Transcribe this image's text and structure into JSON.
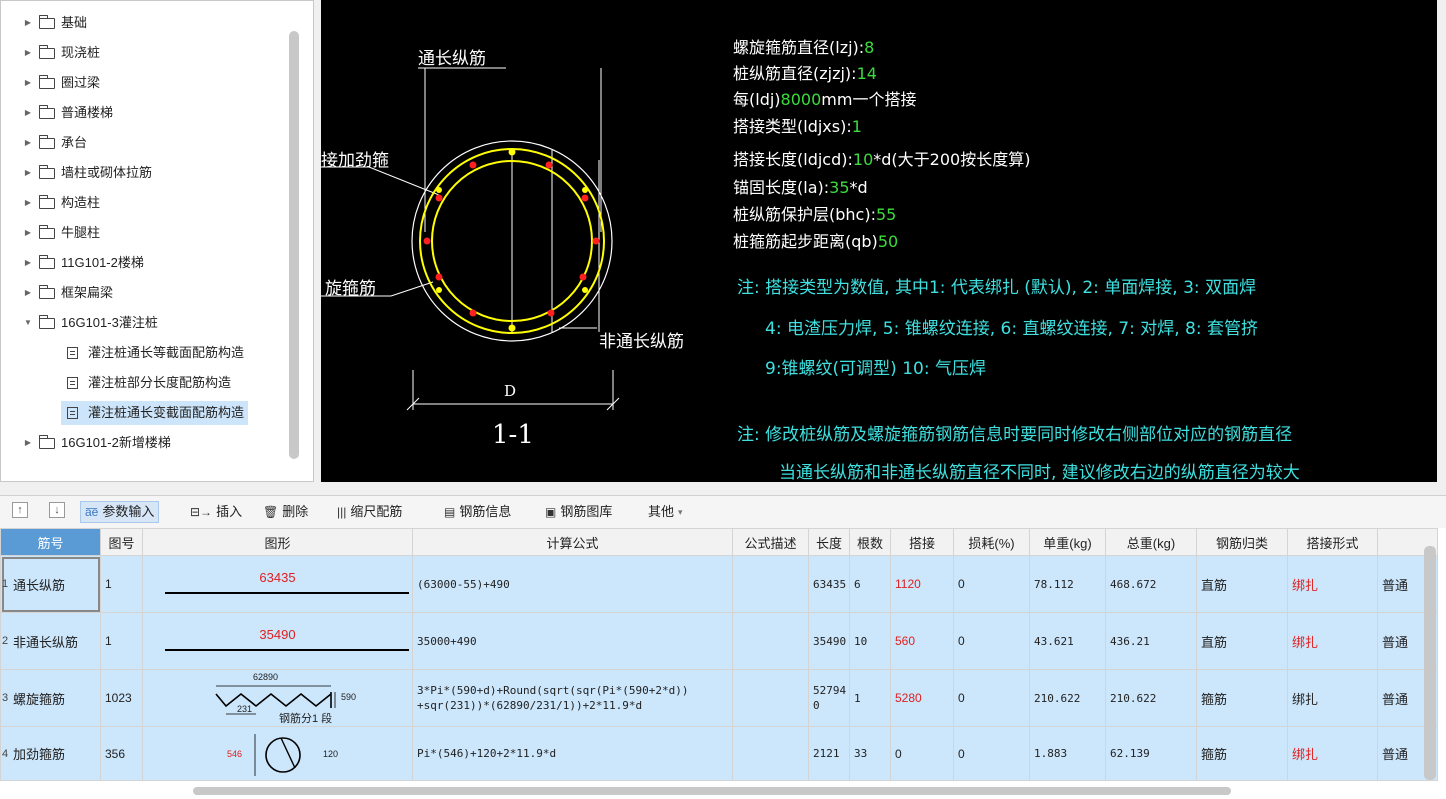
{
  "tree": {
    "items": [
      {
        "label": "基础",
        "type": "folder",
        "expanded": false
      },
      {
        "label": "现浇桩",
        "type": "folder",
        "expanded": false
      },
      {
        "label": "圈过梁",
        "type": "folder",
        "expanded": false
      },
      {
        "label": "普通楼梯",
        "type": "folder",
        "expanded": false
      },
      {
        "label": "承台",
        "type": "folder",
        "expanded": false
      },
      {
        "label": "墙柱或砌体拉筋",
        "type": "folder",
        "expanded": false
      },
      {
        "label": "构造柱",
        "type": "folder",
        "expanded": false
      },
      {
        "label": "牛腿柱",
        "type": "folder",
        "expanded": false
      },
      {
        "label": "11G101-2楼梯",
        "type": "folder",
        "expanded": false
      },
      {
        "label": "框架扁梁",
        "type": "folder",
        "expanded": false
      },
      {
        "label": "16G101-3灌注桩",
        "type": "folder",
        "expanded": true
      },
      {
        "label": "灌注桩通长等截面配筋构造",
        "type": "doc"
      },
      {
        "label": "灌注桩部分长度配筋构造",
        "type": "doc"
      },
      {
        "label": "灌注桩通长变截面配筋构造",
        "type": "doc",
        "selected": true
      },
      {
        "label": "16G101-2新增楼梯",
        "type": "folder",
        "expanded": false
      }
    ]
  },
  "drawing": {
    "labels": {
      "through_bar": "通长纵筋",
      "stiffener": "接加劲箍",
      "spiral": "旋箍筋",
      "non_through_bar": "非通长纵筋",
      "dim_d": "D",
      "section": "1-1"
    },
    "params": [
      {
        "label": "螺旋箍筋直径(lzj):",
        "value": "8",
        "suffix": ""
      },
      {
        "label": "桩纵筋直径(zjzj):",
        "value": "14",
        "suffix": ""
      },
      {
        "label": "每(ldj)",
        "value": "8000",
        "suffix": "mm一个搭接"
      },
      {
        "label": "搭接类型(ldjxs):",
        "value": "1",
        "suffix": ""
      },
      {
        "label": "搭接长度(ldjcd):",
        "value": "10",
        "suffix": "*d(大于200按长度算)"
      },
      {
        "label": "锚固长度(la):",
        "value": "35",
        "suffix": "*d"
      },
      {
        "label": "桩纵筋保护层(bhc):",
        "value": "55",
        "suffix": ""
      },
      {
        "label": "桩箍筋起步距离(qb)",
        "value": "50",
        "suffix": ""
      }
    ],
    "notes": [
      "注: 搭接类型为数值, 其中1: 代表绑扎 (默认), 2: 单面焊接, 3: 双面焊",
      "4: 电渣压力焊, 5: 锥螺纹连接, 6: 直螺纹连接, 7: 对焊, 8: 套管挤",
      "9:锥螺纹(可调型) 10: 气压焊",
      "注: 修改桩纵筋及螺旋箍筋钢筋信息时要同时修改右侧部位对应的钢筋直径",
      "当通长纵筋和非通长纵筋直径不同时, 建议修改右边的纵筋直径为较大"
    ]
  },
  "toolbar": {
    "up_icon": "arrow-up-icon",
    "down_icon": "arrow-down-icon",
    "param_input": "参数输入",
    "insert": "插入",
    "delete": "删除",
    "scale_rebar": "缩尺配筋",
    "rebar_info": "钢筋信息",
    "rebar_library": "钢筋图库",
    "other": "其他"
  },
  "table": {
    "headers": [
      "筋号",
      "图号",
      "图形",
      "计算公式",
      "公式描述",
      "长度",
      "根数",
      "搭接",
      "损耗(%)",
      "单重(kg)",
      "总重(kg)",
      "钢筋归类",
      "搭接形式",
      ""
    ],
    "rows": [
      {
        "num": "1",
        "name": "通长纵筋",
        "fig": "1",
        "shape_value": "63435",
        "formula": "(63000-55)+490",
        "formula2": "",
        "desc": "",
        "length": "63435",
        "count": "6",
        "lap": "1120",
        "loss": "0",
        "unit_w": "78.112",
        "total_w": "468.672",
        "category": "直筋",
        "lap_type": "绑扎",
        "extra": "普通"
      },
      {
        "num": "2",
        "name": "非通长纵筋",
        "fig": "1",
        "shape_value": "35490",
        "formula": "35000+490",
        "formula2": "",
        "desc": "",
        "length": "35490",
        "count": "10",
        "lap": "560",
        "loss": "0",
        "unit_w": "43.621",
        "total_w": "436.21",
        "category": "直筋",
        "lap_type": "绑扎",
        "extra": "普通"
      },
      {
        "num": "3",
        "name": "螺旋箍筋",
        "fig": "1023",
        "shape_value": "62890",
        "shape_sub1": "231",
        "shape_sub2": "590",
        "shape_note": "钢筋分1 段",
        "formula": "3*Pi*(590+d)+Round(sqrt(sqr(Pi*(590+2*d))",
        "formula2": "+sqr(231))*(62890/231/1))+2*11.9*d",
        "desc": "",
        "length": "527940",
        "count": "1",
        "lap": "5280",
        "loss": "0",
        "unit_w": "210.622",
        "total_w": "210.622",
        "category": "箍筋",
        "lap_type": "绑扎",
        "extra": "普通"
      },
      {
        "num": "4",
        "name": "加劲箍筋",
        "fig": "356",
        "shape_value": "546",
        "shape_sub1": "120",
        "formula": "Pi*(546)+120+2*11.9*d",
        "formula2": "",
        "desc": "",
        "length": "2121",
        "count": "33",
        "lap": "0",
        "loss": "0",
        "unit_w": "1.883",
        "total_w": "62.139",
        "category": "箍筋",
        "lap_type": "绑扎",
        "extra": "普通"
      }
    ]
  },
  "colors": {
    "selection": "#cce6fb",
    "header_active": "#5b9bd5",
    "cad_green": "#3cdc3c",
    "cad_cyan": "#3ee0e0",
    "cad_yellow": "#ffff00",
    "cad_red": "#ff2020",
    "red_text": "#e02020"
  }
}
